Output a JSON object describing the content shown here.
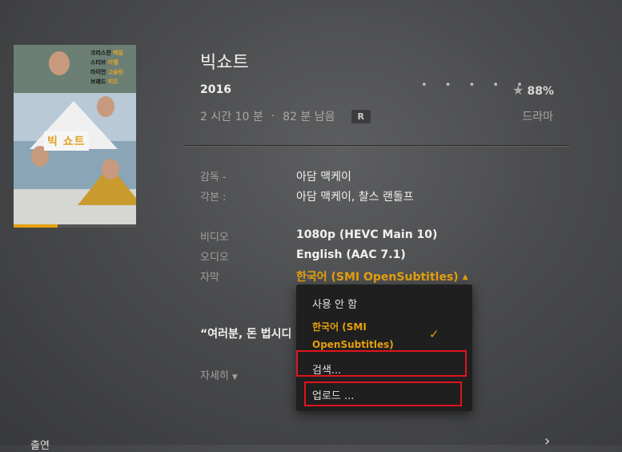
{
  "movie": {
    "title": "빅쇼트",
    "year": "2016",
    "rating_dots": "• • • • •",
    "rating": "88%",
    "duration": "2 시간 10 분",
    "remaining": "82 분 남음",
    "content_rating": "R",
    "genre": "드라마",
    "watch_progress_percent": 36
  },
  "poster": {
    "title_text": "빅 쇼트",
    "names": [
      {
        "name": "크리스찬",
        "tag": "베일"
      },
      {
        "name": "스티브",
        "tag": "카렐"
      },
      {
        "name": "라이언",
        "tag": "고슬링"
      },
      {
        "name": "브래드",
        "tag": "피트"
      }
    ]
  },
  "details": {
    "director_label": "감독 -",
    "director": "아담 맥케이",
    "writer_label": "각본 :",
    "writers": "아담 맥케이, 찰스 랜돌프",
    "video_label": "비디오",
    "video": "1080p (HEVC Main 10)",
    "audio_label": "오디오",
    "audio": "English (AAC 7.1)",
    "subtitle_label": "자막",
    "subtitle": "한국어 (SMI OpenSubtitles)",
    "subtitle_caret": "▲"
  },
  "tagline": "“여러분, 돈 법시디",
  "more": {
    "label": "자세히",
    "caret": "▼"
  },
  "subtitle_menu": {
    "none": "사용 안 함",
    "selected_line1": "한국어 (SMI",
    "selected_line2": "OpenSubtitles)",
    "check": "✓",
    "search": "검색...",
    "upload": "업로드 ..."
  },
  "bottom": {
    "label": "출연",
    "chevron": "›"
  },
  "colors": {
    "accent": "#e5a00d",
    "highlight": "#e0141e"
  }
}
